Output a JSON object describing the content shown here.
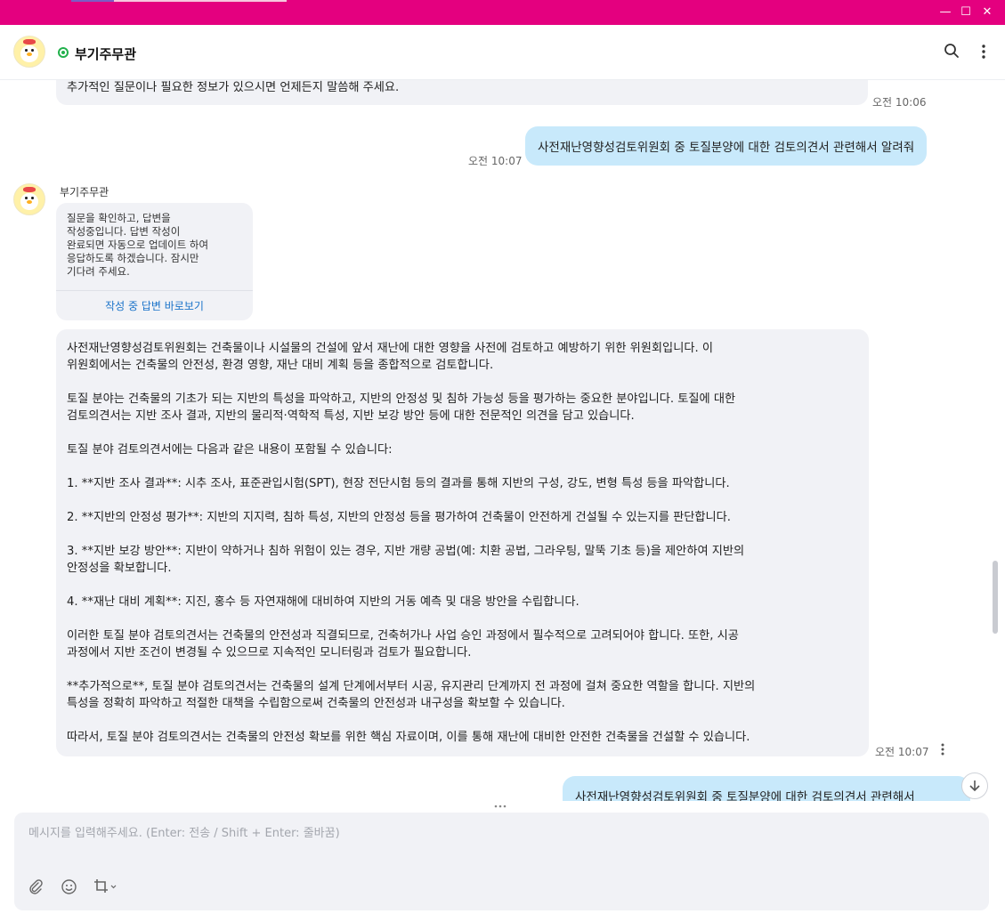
{
  "window": {
    "minimize": "—",
    "maximize": "☐",
    "close": "✕"
  },
  "header": {
    "title": "부기주무관",
    "status_icon": "online-status-icon",
    "search_icon": "search-icon",
    "menu_icon": "more-vertical-icon"
  },
  "messages": {
    "prev_bot": {
      "text": "추가적인 질문이나 필요한 정보가 있으시면 언제든지 말씀해 주세요.",
      "time": "오전 10:06"
    },
    "user_1": {
      "text": "사전재난영향성검토위원회 중 토질분양에 대한 검토의견서 관련해서 알려줘",
      "time": "오전 10:07"
    },
    "bot_sender": "부기주무관",
    "pending": {
      "text": "질문을 확인하고, 답변을\n작성중입니다. 답변 작성이\n완료되면 자동으로 업데이트 하여\n응답하도록 하겠습니다. 잠시만\n기다려 주세요.",
      "link": "작성 중 답변 바로보기"
    },
    "bot_answer": {
      "text": "사전재난영향성검토위원회는 건축물이나 시설물의 건설에 앞서 재난에 대한 영향을 사전에 검토하고 예방하기 위한 위원회입니다. 이\n위원회에서는 건축물의 안전성, 환경 영향, 재난 대비 계획 등을 종합적으로 검토합니다.\n\n토질 분야는 건축물의 기초가 되는 지반의 특성을 파악하고, 지반의 안정성 및 침하 가능성 등을 평가하는 중요한 분야입니다. 토질에 대한\n검토의견서는 지반 조사 결과, 지반의 물리적·역학적 특성, 지반 보강 방안 등에 대한 전문적인 의견을 담고 있습니다.\n\n토질 분야 검토의견서에는 다음과 같은 내용이 포함될 수 있습니다:\n\n1. **지반 조사 결과**: 시추 조사, 표준관입시험(SPT), 현장 전단시험 등의 결과를 통해 지반의 구성, 강도, 변형 특성 등을 파악합니다.\n\n2. **지반의 안정성 평가**: 지반의 지지력, 침하 특성, 지반의 안정성 등을 평가하여 건축물이 안전하게 건설될 수 있는지를 판단합니다.\n\n3. **지반 보강 방안**: 지반이 약하거나 침하 위험이 있는 경우, 지반 개량 공법(예: 치환 공법, 그라우팅, 말뚝 기초 등)을 제안하여 지반의\n안정성을 확보합니다.\n\n4. **재난 대비 계획**: 지진, 홍수 등 자연재해에 대비하여 지반의 거동 예측 및 대응 방안을 수립합니다.\n\n이러한 토질 분야 검토의견서는 건축물의 안전성과 직결되므로, 건축허가나 사업 승인 과정에서 필수적으로 고려되어야 합니다. 또한, 시공\n과정에서 지반 조건이 변경될 수 있으므로 지속적인 모니터링과 검토가 필요합니다.\n\n**추가적으로**, 토질 분야 검토의견서는 건축물의 설계 단계에서부터 시공, 유지관리 단계까지 전 과정에 걸쳐 중요한 역할을 합니다. 지반의\n특성을 정확히 파악하고 적절한 대책을 수립함으로써 건축물의 안전성과 내구성을 확보할 수 있습니다.\n\n따라서, 토질 분야 검토의견서는 건축물의 안전성 확보를 위한 핵심 자료이며, 이를 통해 재난에 대비한 안전한 건축물을 건설할 수 있습니다.",
      "time": "오전 10:07"
    },
    "user_2_partial": "사전재난영향성검토위원회 중 토질분양에 대한 검토의견서 관련해서"
  },
  "composer": {
    "placeholder": "메시지를 입력해주세요. (Enter: 전송 / Shift + Enter: 줄바꿈)",
    "attach_icon": "paperclip-icon",
    "emoji_icon": "emoji-icon",
    "crop_icon": "crop-icon"
  },
  "colors": {
    "titlebar": "#e4007f",
    "user_bubble": "#c8e9fb",
    "bot_bubble": "#f1f2f6",
    "link": "#1a73c9"
  }
}
